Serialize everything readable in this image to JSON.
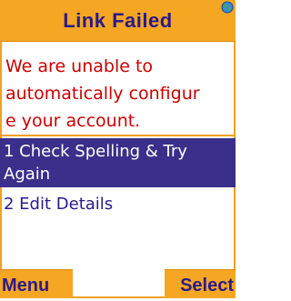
{
  "header": {
    "title": "Link Failed",
    "indicator_icon": "globe-icon"
  },
  "message": {
    "lines": [
      "We are unable to",
      "automatically configur",
      "e your account."
    ]
  },
  "menu": {
    "items": [
      {
        "lines": [
          "1 Check Spelling & Try",
          "Again"
        ],
        "selected": true
      },
      {
        "lines": [
          "2 Edit Details"
        ],
        "selected": false
      }
    ]
  },
  "softkeys": {
    "left": "Menu",
    "right": "Select"
  },
  "colors": {
    "bar": "#f5a623",
    "title_text": "#2a1a8a",
    "message_text": "#cc0000",
    "selection": "#3a2f8a"
  }
}
